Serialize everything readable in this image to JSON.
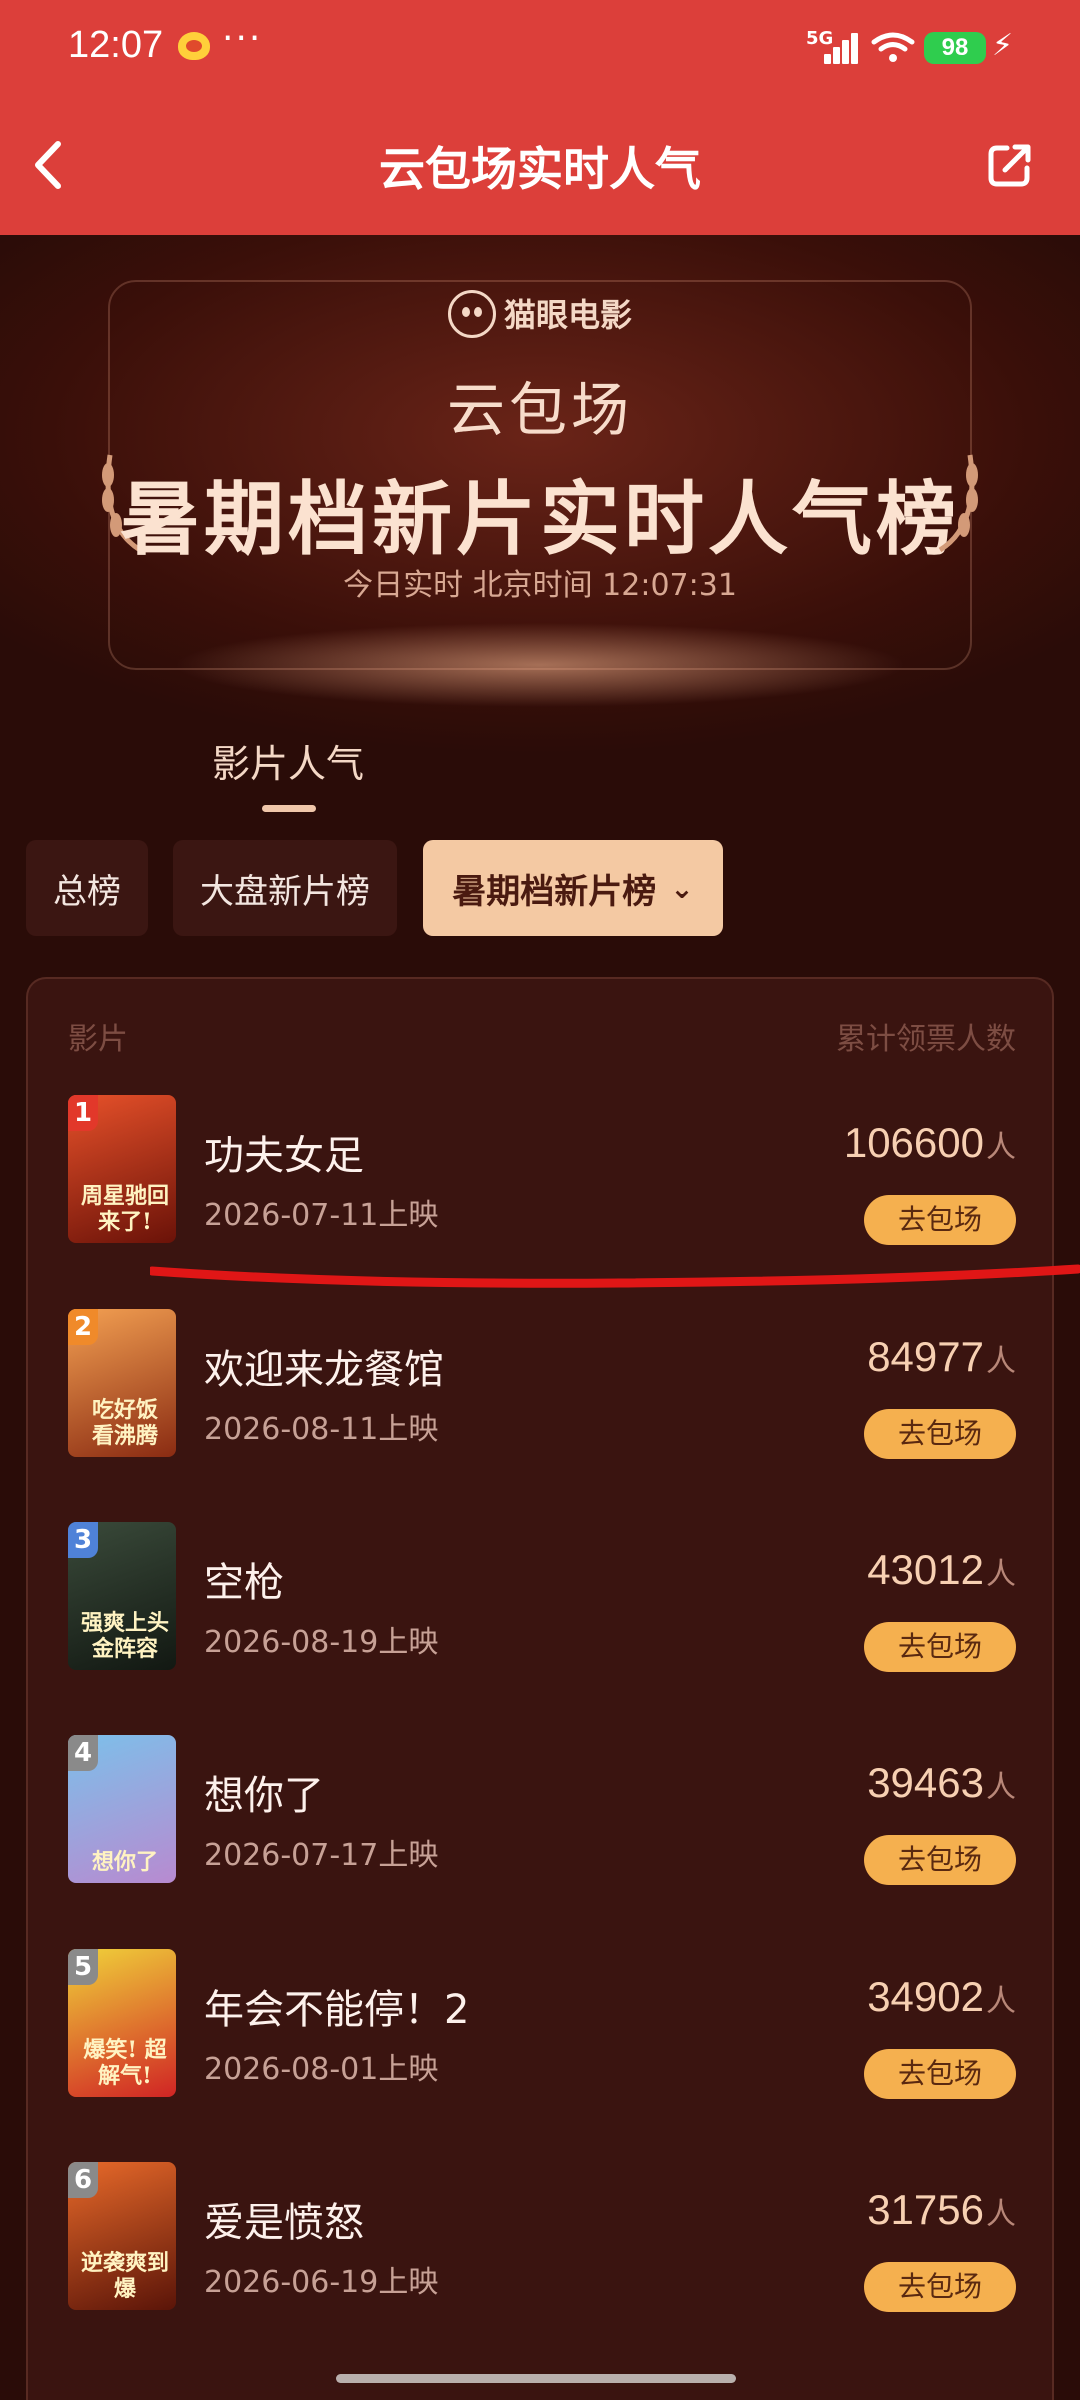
{
  "status": {
    "time": "12:07",
    "dots": "···",
    "network": "5G",
    "battery": "98"
  },
  "nav": {
    "title": "云包场实时人气"
  },
  "banner": {
    "brand": "猫眼电影",
    "subtitle": "云包场",
    "title": "暑期档新片实时人气榜",
    "timestamp": "今日实时 北京时间 12:07:31"
  },
  "tab": {
    "label": "影片人气"
  },
  "filters": [
    {
      "label": "总榜"
    },
    {
      "label": "大盘新片榜"
    },
    {
      "label": "暑期档新片榜"
    }
  ],
  "list": {
    "header_left": "影片",
    "header_right": "累计领票人数",
    "unit": "人",
    "button_label": "去包场",
    "items": [
      {
        "rank": "1",
        "title": "功夫女足",
        "date": "2026-07-11上映",
        "count": "106600",
        "poster_text": "周星驰回来了!",
        "rank_color": "#e2382a",
        "poster_color": "#c0321c"
      },
      {
        "rank": "2",
        "title": "欢迎来龙餐馆",
        "date": "2026-08-11上映",
        "count": "84977",
        "poster_text": "吃好饭 看沸腾",
        "rank_color": "#f08a2a",
        "poster_color": "#d4552a"
      },
      {
        "rank": "3",
        "title": "空枪",
        "date": "2026-08-19上映",
        "count": "43012",
        "poster_text": "强爽上头 金阵容",
        "rank_color": "#4f82d8",
        "poster_color": "#2c3a2e"
      },
      {
        "rank": "4",
        "title": "想你了",
        "date": "2026-07-17上映",
        "count": "39463",
        "poster_text": "想你了",
        "rank_color": "#8a8a8a",
        "poster_color": "#3c89c9"
      },
      {
        "rank": "5",
        "title": "年会不能停！2",
        "date": "2026-08-01上映",
        "count": "34902",
        "poster_text": "爆笑! 超解气!",
        "rank_color": "#8a8a8a",
        "poster_color": "#d8282a"
      },
      {
        "rank": "6",
        "title": "爱是愤怒",
        "date": "2026-06-19上映",
        "count": "31756",
        "poster_text": "逆袭爽到爆",
        "rank_color": "#8a8a8a",
        "poster_color": "#b8341c"
      }
    ]
  }
}
